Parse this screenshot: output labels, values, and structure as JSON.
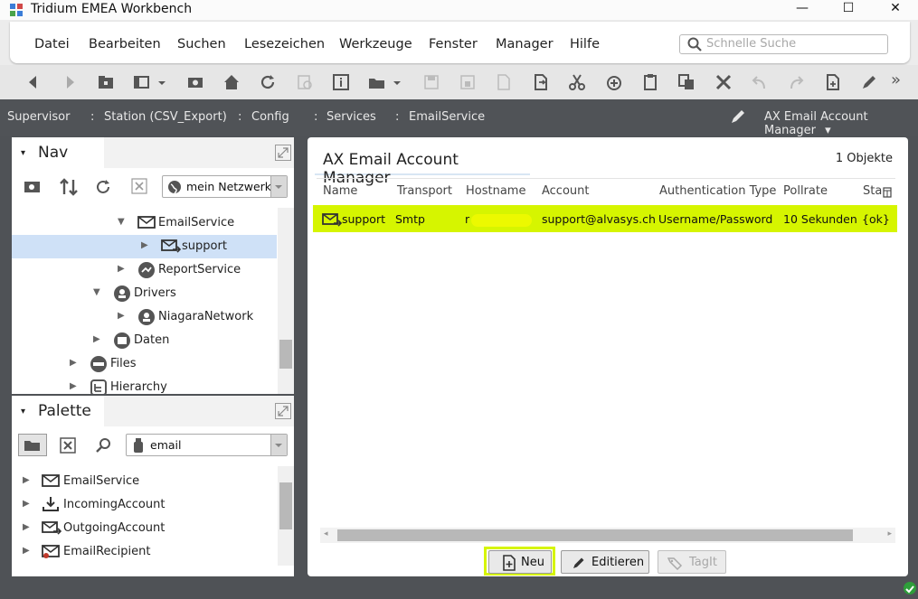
{
  "window": {
    "title": "Tridium EMEA Workbench",
    "minimize": "—",
    "maximize": "☐",
    "close": "✕"
  },
  "menu": {
    "items": [
      "Datei",
      "Bearbeiten",
      "Suchen",
      "Lesezeichen",
      "Werkzeuge",
      "Fenster",
      "Manager",
      "Hilfe"
    ],
    "search_placeholder": "Schnelle Suche"
  },
  "toolbar": {
    "icons": [
      "back-icon",
      "forward-icon",
      "folder-icon",
      "window-icon",
      "screenshot-icon",
      "home-icon",
      "refresh-icon",
      "sync-icon",
      "info-icon",
      "open-folder-icon",
      "save-icon",
      "save-all-icon",
      "export-icon",
      "document-arrow-icon",
      "cut-icon",
      "add-icon",
      "clipboard-icon",
      "copy-icon",
      "delete-icon",
      "undo-icon",
      "redo-icon",
      "new-document-icon",
      "edit-icon",
      "more-icon"
    ],
    "more_glyph": "»"
  },
  "path": {
    "crumbs": [
      "Supervisor",
      "Station (CSV_Export)",
      "Config",
      "Services",
      "EmailService"
    ],
    "separator": ":",
    "manager_view": "AX Email Account Manager",
    "manager_caret": "▾"
  },
  "nav": {
    "title": "Nav",
    "network": "mein Netzwerk",
    "tree": [
      {
        "label": "EmailService",
        "icon": "email-service-icon",
        "expanded": true,
        "selected": false
      },
      {
        "label": "support",
        "icon": "email-account-icon",
        "expanded": false,
        "selected": true
      },
      {
        "label": "ReportService",
        "icon": "report-icon",
        "expanded": false,
        "selected": false
      },
      {
        "label": "Drivers",
        "icon": "drivers-icon",
        "expanded": true,
        "selected": false
      },
      {
        "label": "NiagaraNetwork",
        "icon": "network-icon",
        "expanded": false,
        "selected": false
      },
      {
        "label": "Daten",
        "icon": "data-icon",
        "expanded": false,
        "selected": false
      },
      {
        "label": "Files",
        "icon": "files-icon",
        "expanded": false,
        "selected": false
      },
      {
        "label": "Hierarchy",
        "icon": "hierarchy-icon",
        "expanded": false,
        "selected": false
      }
    ]
  },
  "palette": {
    "title": "Palette",
    "module": "email",
    "items": [
      {
        "label": "EmailService",
        "icon": "email-service-icon"
      },
      {
        "label": "IncomingAccount",
        "icon": "incoming-icon"
      },
      {
        "label": "OutgoingAccount",
        "icon": "outgoing-icon"
      },
      {
        "label": "EmailRecipient",
        "icon": "recipient-icon"
      }
    ]
  },
  "manager": {
    "title": "AX Email Account Manager",
    "count": "1 Objekte",
    "columns": [
      "Name",
      "Transport",
      "Hostname",
      "Account",
      "Authentication Type",
      "Pollrate",
      "Sta"
    ],
    "rows": [
      {
        "name": "support",
        "transport": "Smtp",
        "hostname": "r",
        "account": "support@alvasys.ch",
        "auth": "Username/Password",
        "pollrate": "10 Sekunden",
        "status": "{ok}"
      }
    ],
    "buttons": {
      "new": "Neu",
      "edit": "Editieren",
      "tag": "TagIt"
    }
  },
  "colors": {
    "highlight": "#d6f500",
    "selected_row": "#cfe1f7",
    "dark_bg": "#4f5256"
  }
}
